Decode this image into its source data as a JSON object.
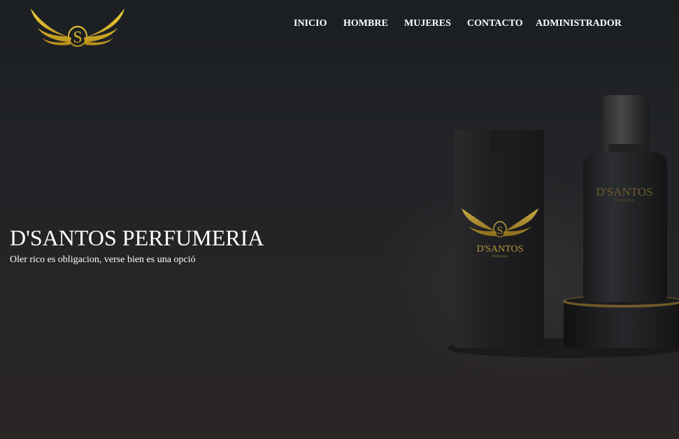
{
  "brand": {
    "logo_letter": "S",
    "logo_icon": "winged-s-logo",
    "gold": "#d4af37"
  },
  "nav": {
    "items": [
      {
        "label": "INICIO"
      },
      {
        "label": "HOMBRE"
      },
      {
        "label": "MUJERES"
      },
      {
        "label": "CONTACTO"
      },
      {
        "label": "ADMINISTRADOR"
      }
    ]
  },
  "hero": {
    "title": "D'SANTOS PERFUMERIA",
    "subtitle": "Oler rico es obligacion, verse bien es una opció"
  },
  "product": {
    "box_brand": "D'SANTOS",
    "box_sub": "Perfumeria",
    "bottle_brand": "D'SANTOS",
    "bottle_sub": "Perfumeria"
  }
}
